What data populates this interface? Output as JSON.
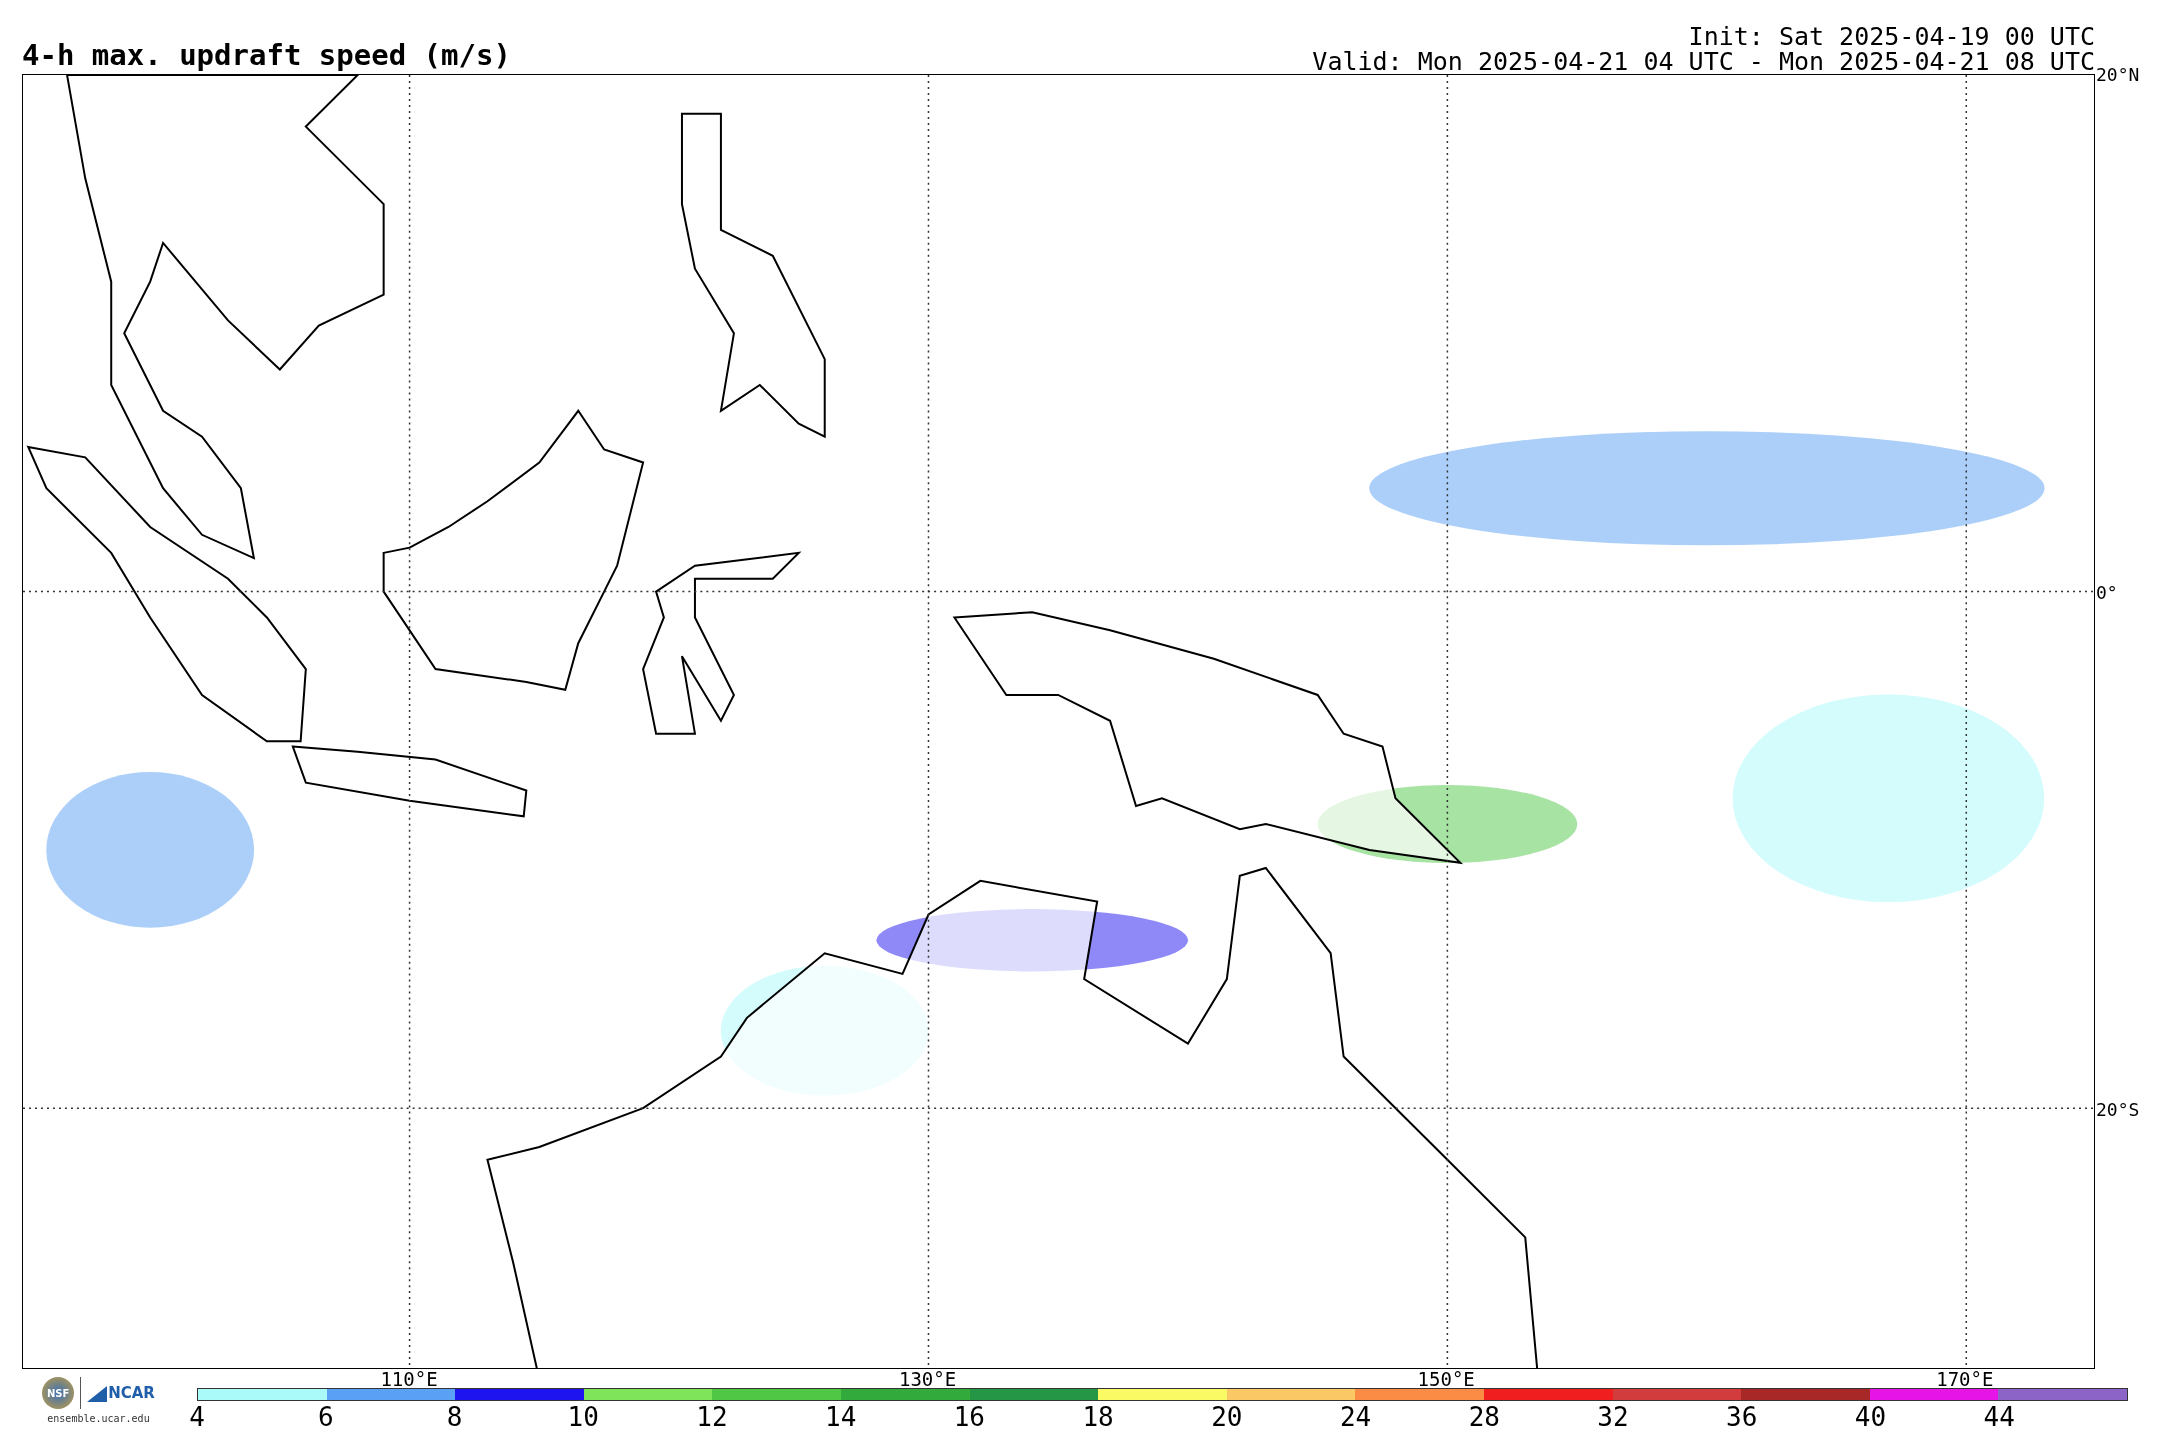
{
  "title": "4-h max. updraft speed (m/s)",
  "init": "Init: Sat 2025-04-19 00 UTC",
  "valid": "Valid: Mon 2025-04-21 04 UTC - Mon 2025-04-21 08 UTC",
  "map": {
    "lat_labels": [
      "20°N",
      "0°",
      "20°S"
    ],
    "lon_labels": [
      "110°E",
      "130°E",
      "150°E",
      "170°E"
    ]
  },
  "logo": {
    "nsf": "NSF",
    "ncar": "NCAR",
    "url": "ensemble.ucar.edu"
  },
  "colorbar": {
    "segments": [
      {
        "color": "#aafafa"
      },
      {
        "color": "#5aa0f5"
      },
      {
        "color": "#1e14f0"
      },
      {
        "color": "#80e45a"
      },
      {
        "color": "#50c846"
      },
      {
        "color": "#32aa3c"
      },
      {
        "color": "#249646"
      },
      {
        "color": "#fafa64"
      },
      {
        "color": "#fac864"
      },
      {
        "color": "#fa8c46"
      },
      {
        "color": "#f01e1e"
      },
      {
        "color": "#d23c3c"
      },
      {
        "color": "#a82828"
      },
      {
        "color": "#e614e6"
      },
      {
        "color": "#8c64c8"
      }
    ],
    "ticks": [
      "4",
      "6",
      "8",
      "10",
      "12",
      "14",
      "16",
      "18",
      "20",
      "24",
      "28",
      "32",
      "36",
      "40",
      "44"
    ]
  }
}
